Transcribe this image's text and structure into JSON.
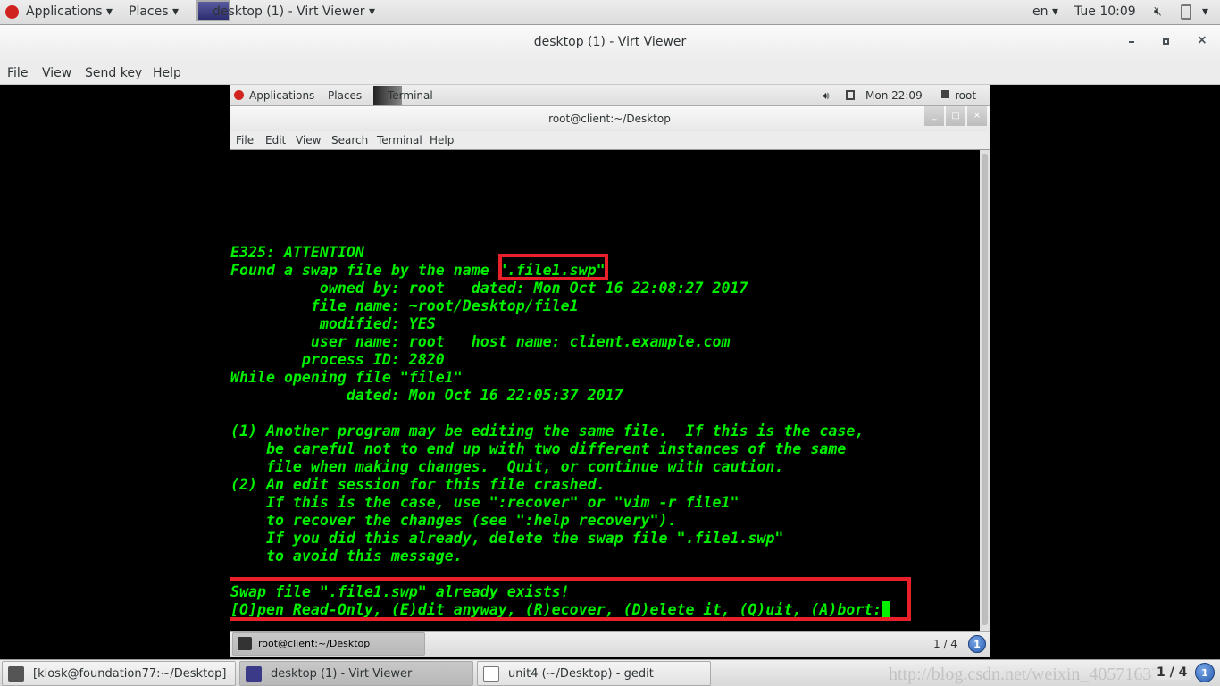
{
  "host_top_bar": {
    "applications": "Applications",
    "places": "Places",
    "window_menu": "desktop (1) - Virt Viewer",
    "lang": "en",
    "clock": "Tue 10:09"
  },
  "virt_viewer": {
    "title": "desktop (1) - Virt Viewer",
    "menu": [
      "File",
      "View",
      "Send key",
      "Help"
    ]
  },
  "guest_top_bar": {
    "applications": "Applications",
    "places": "Places",
    "app": "Terminal",
    "clock": "Mon 22:09",
    "user": "root"
  },
  "terminal": {
    "title": "root@client:~/Desktop",
    "menu": [
      "File",
      "Edit",
      "View",
      "Search",
      "Terminal",
      "Help"
    ],
    "lines": [
      "E325: ATTENTION",
      "Found a swap file by the name \".file1.swp\"",
      "          owned by: root   dated: Mon Oct 16 22:08:27 2017",
      "         file name: ~root/Desktop/file1",
      "          modified: YES",
      "         user name: root   host name: client.example.com",
      "        process ID: 2820",
      "While opening file \"file1\"",
      "             dated: Mon Oct 16 22:05:37 2017",
      "",
      "(1) Another program may be editing the same file.  If this is the case,",
      "    be careful not to end up with two different instances of the same",
      "    file when making changes.  Quit, or continue with caution.",
      "(2) An edit session for this file crashed.",
      "    If this is the case, use \":recover\" or \"vim -r file1\"",
      "    to recover the changes (see \":help recovery\").",
      "    If you did this already, delete the swap file \".file1.swp\"",
      "    to avoid this message.",
      "",
      "Swap file \".file1.swp\" already exists!",
      "[O]pen Read-Only, (E)dit anyway, (R)ecover, (D)elete it, (Q)uit, (A)bort:"
    ]
  },
  "guest_taskbar": {
    "task": "root@client:~/Desktop",
    "pager": "1 / 4",
    "badge": "1"
  },
  "host_taskbar": {
    "tasks": [
      "[kiosk@foundation77:~/Desktop]",
      "desktop (1) - Virt Viewer",
      "unit4 (~/Desktop) - gedit"
    ],
    "pager": "1 / 4",
    "badge": "1"
  },
  "watermark": "http://blog.csdn.net/weixin_40571637",
  "colors": {
    "terminal_text": "#00f000",
    "highlight_box": "#e8202a"
  }
}
